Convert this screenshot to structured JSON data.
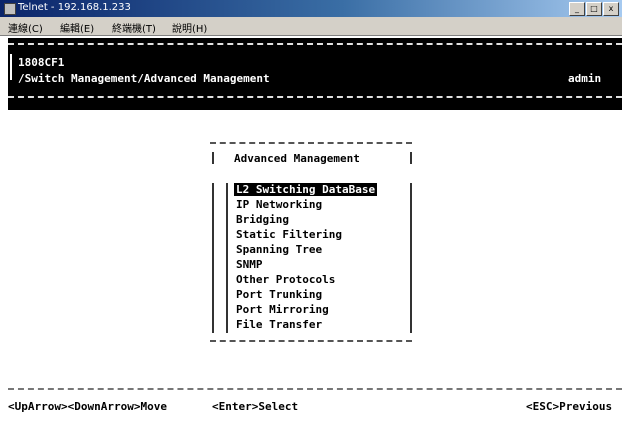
{
  "window": {
    "title": "Telnet - 192.168.1.233",
    "controls": [
      "_",
      "□",
      "x"
    ]
  },
  "menubar": {
    "items": [
      "連線(C)",
      "編輯(E)",
      "終端機(T)",
      "說明(H)"
    ]
  },
  "terminal": {
    "device": "1808CF1",
    "path": "/Switch Management/Advanced Management",
    "user": "admin",
    "menu_title": "Advanced Management",
    "menu_items": [
      "L2 Switching DataBase",
      "IP Networking",
      "Bridging",
      "Static Filtering",
      "Spanning Tree",
      "SNMP",
      "Other Protocols",
      "Port Trunking",
      "Port Mirroring",
      "File Transfer"
    ],
    "selected_index": 0,
    "footer": {
      "move": "<UpArrow><DownArrow>Move",
      "select": "<Enter>Select",
      "previous": "<ESC>Previous"
    }
  }
}
